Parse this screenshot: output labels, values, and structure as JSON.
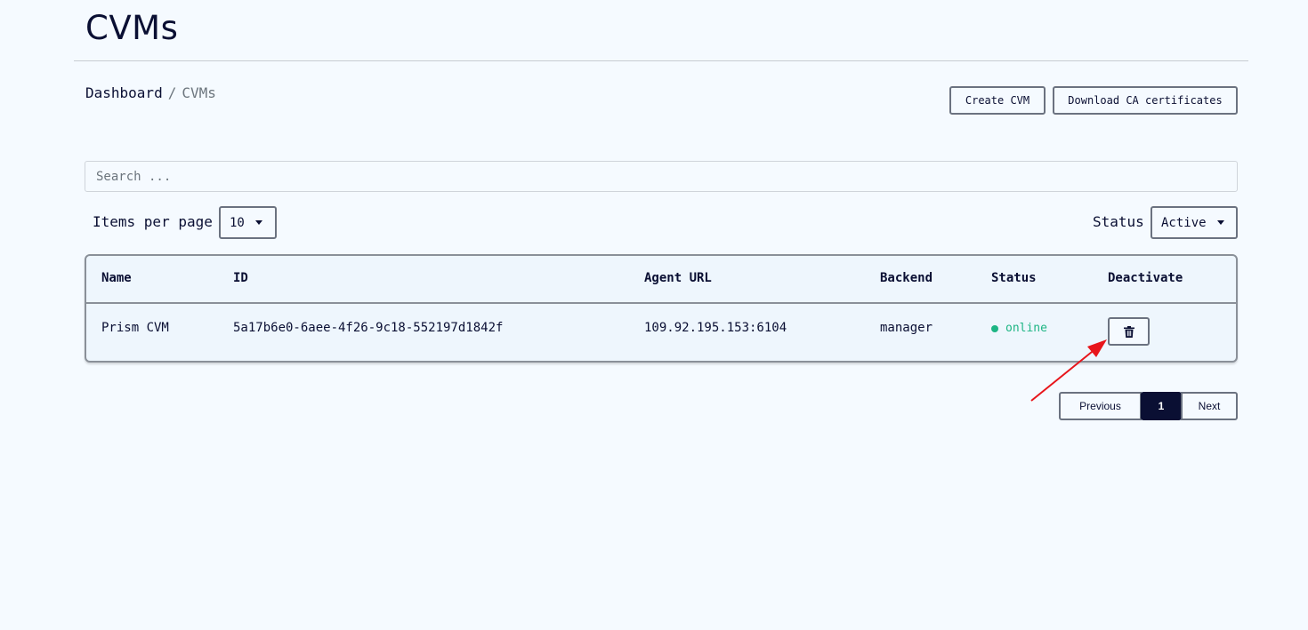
{
  "header": {
    "title": "CVMs"
  },
  "breadcrumb": {
    "root": "Dashboard",
    "separator": "/",
    "current": "CVMs"
  },
  "toolbar": {
    "create_label": "Create CVM",
    "download_label": "Download CA certificates"
  },
  "search": {
    "placeholder": "Search ...",
    "value": ""
  },
  "filters": {
    "items_per_page_label": "Items per page",
    "items_per_page_value": "10",
    "status_label": "Status",
    "status_value": "Active"
  },
  "table": {
    "columns": [
      "Name",
      "ID",
      "Agent URL",
      "Backend",
      "Status",
      "Deactivate"
    ],
    "rows": [
      {
        "name": "Prism CVM",
        "id": "5a17b6e0-6aee-4f26-9c18-552197d1842f",
        "agent_url": "109.92.195.153:6104",
        "backend": "manager",
        "status": "online"
      }
    ]
  },
  "pagination": {
    "previous_label": "Previous",
    "current_page": "1",
    "next_label": "Next"
  },
  "colors": {
    "primary": "#0a0f33",
    "online": "#1db584",
    "background": "#f5faff",
    "annotation": "#e8151b"
  },
  "icons": {
    "deactivate": "trash-icon"
  }
}
